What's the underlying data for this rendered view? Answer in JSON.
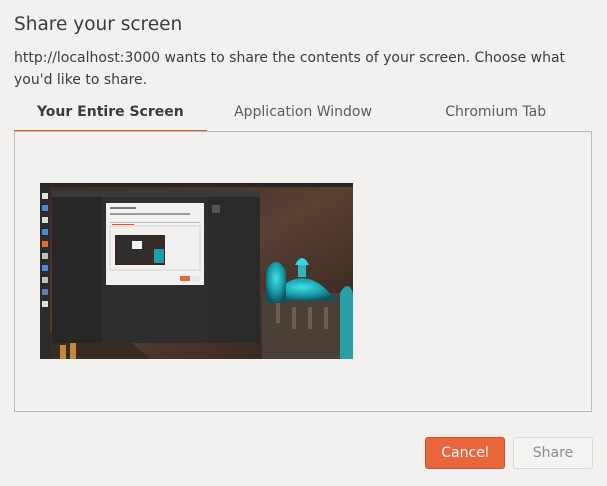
{
  "dialog": {
    "title": "Share your screen",
    "message": "http://localhost:3000 wants to share the contents of your screen. Choose what you'd like to share."
  },
  "tabs": [
    {
      "label": "Your Entire Screen",
      "active": true
    },
    {
      "label": "Application Window",
      "active": false
    },
    {
      "label": "Chromium Tab",
      "active": false
    }
  ],
  "thumbnail": {
    "name": "entire-screen-thumbnail",
    "selected": false
  },
  "buttons": {
    "cancel_label": "Cancel",
    "share_label": "Share",
    "share_enabled": false
  },
  "colors": {
    "accent": "#e95420",
    "cancel_bg": "#e9653a",
    "dialog_bg": "#f2f1f0"
  }
}
